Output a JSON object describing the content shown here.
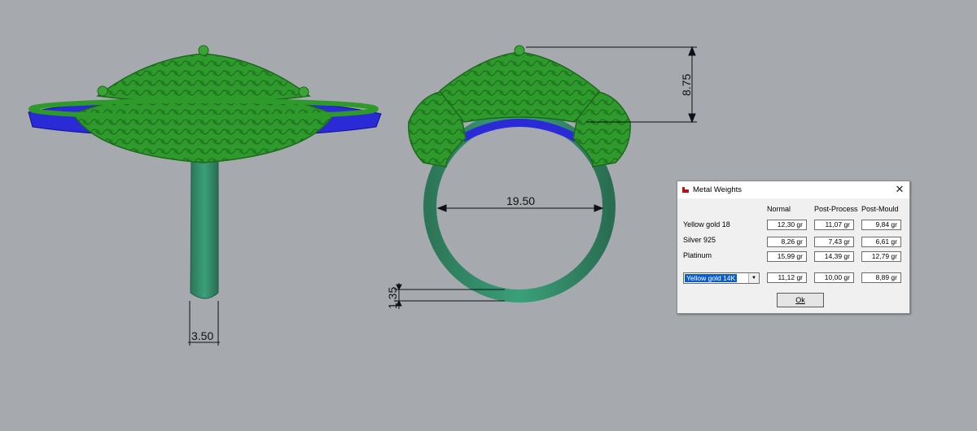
{
  "dimensions": {
    "shank_width": "3.50",
    "ring_inner_diameter": "19.50",
    "head_height": "8.75",
    "shank_thickness": "1.35"
  },
  "colors": {
    "background": "#a6a9ad",
    "metal_green": "#2d8f2a",
    "shank_green": "#2f8a6a",
    "stone_blue": "#2a2ad6",
    "dialog_select": "#0a5dd0"
  },
  "dialog": {
    "title": "Metal Weights",
    "close_icon": "close-icon",
    "columns": [
      "Normal",
      "Post-Process",
      "Post-Mould"
    ],
    "rows": [
      {
        "label": "Yellow gold 18",
        "values": [
          "12,30 gr",
          "11,07 gr",
          "9,84 gr"
        ]
      },
      {
        "label": "Silver 925",
        "values": [
          "8,26 gr",
          "7,43 gr",
          "6,61 gr"
        ]
      },
      {
        "label": "Platinum",
        "values": [
          "15,99 gr",
          "14,39 gr",
          "12,79 gr"
        ]
      }
    ],
    "selected_metal": "Yellow gold 14K",
    "selected_values": [
      "11,12 gr",
      "10,00 gr",
      "8,89 gr"
    ],
    "ok_label": "Ok"
  }
}
